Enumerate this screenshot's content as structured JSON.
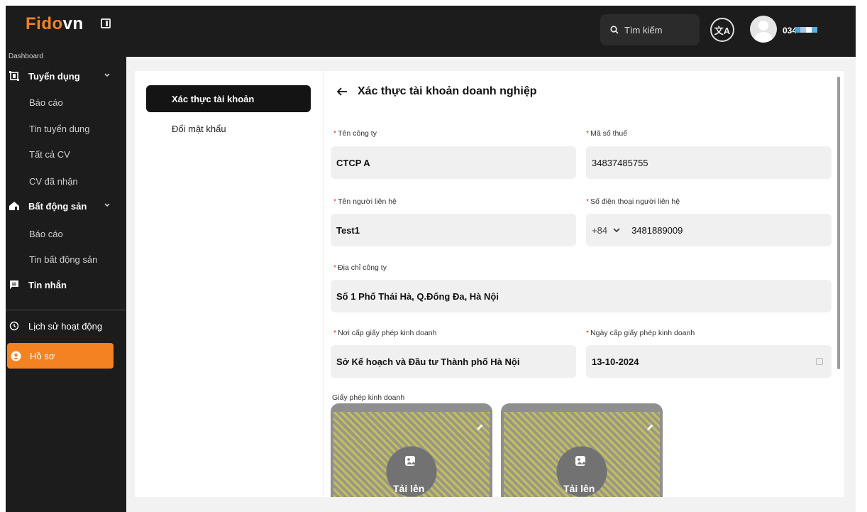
{
  "brand": {
    "name_main": "Fido",
    "name_suffix": "vn"
  },
  "header": {
    "search_placeholder": "Tìm kiếm",
    "user_id": "034"
  },
  "sidebar": {
    "section_label": "Dashboard",
    "groups": [
      {
        "label": "Tuyển dụng",
        "icon": "recruitment-icon",
        "items": [
          "Báo cáo",
          "Tin tuyển dụng",
          "Tất cả CV",
          "CV đã nhận"
        ]
      },
      {
        "label": "Bất động sản",
        "icon": "real-estate-icon",
        "items": [
          "Báo cáo",
          "Tin bất động sản"
        ]
      }
    ],
    "messages": "Tin nhắn",
    "history": "Lịch sử hoạt động",
    "profile": "Hồ sơ"
  },
  "profile_menu": {
    "verify": "Xác thực tài khoản",
    "change_password": "Đổi mật khẩu"
  },
  "form": {
    "title": "Xác thực tài khoản doanh nghiệp",
    "company_name": {
      "label": "Tên công ty",
      "value": "CTCP A"
    },
    "tax_code": {
      "label": "Mã số thuế",
      "value": "34837485755"
    },
    "contact_name": {
      "label": "Tên người liên hệ",
      "value": "Test1"
    },
    "contact_phone": {
      "label": "Số điện thoại người liên hệ",
      "prefix": "+84",
      "value": "3481889009"
    },
    "address": {
      "label": "Địa chỉ công ty",
      "value": "Số 1 Phố Thái Hà, Q.Đống Đa, Hà Nội"
    },
    "license_issuer": {
      "label": "Nơi cấp giấy phép kinh doanh",
      "value": "Sở Kế hoạch và Đầu tư Thành phố Hà Nội"
    },
    "license_date": {
      "label": "Ngày cấp giấy phép kinh doanh",
      "value": "13-10-2024"
    },
    "license_images": {
      "label": "Giấy phép kinh doanh",
      "upload_label": "Tải lên"
    }
  },
  "colors": {
    "accent": "#f58220",
    "sidebar_bg": "#1c1c1c",
    "required": "#e0342b"
  }
}
